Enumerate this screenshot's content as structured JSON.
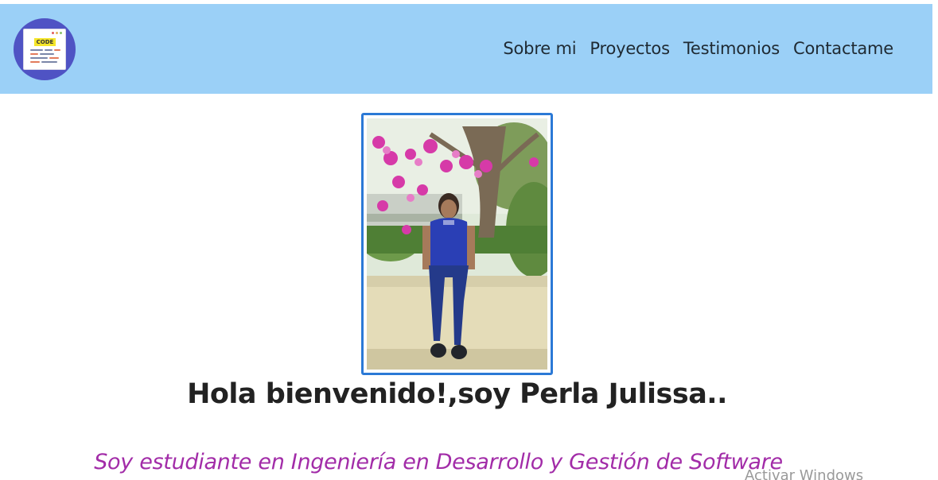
{
  "brand": {
    "logo_label": "CODE",
    "logo_icon": "code-window-icon",
    "logo_color": "#4f53c4"
  },
  "navbar": {
    "background": "#9bd0f7",
    "links": [
      {
        "label": "Sobre mi"
      },
      {
        "label": "Proyectos"
      },
      {
        "label": "Testimonios"
      },
      {
        "label": "Contactame"
      }
    ]
  },
  "hero": {
    "profile_photo": "profile-photo",
    "frame_color": "#2b79d6",
    "greeting": "Hola bienvenido!,soy Perla Julissa..",
    "subtitle": "Soy estudiante en Ingeniería en Desarrollo y Gestión de Software",
    "subtitle_color": "#a22ca8"
  },
  "system_overlay": {
    "watermark": "Activar Windows"
  }
}
